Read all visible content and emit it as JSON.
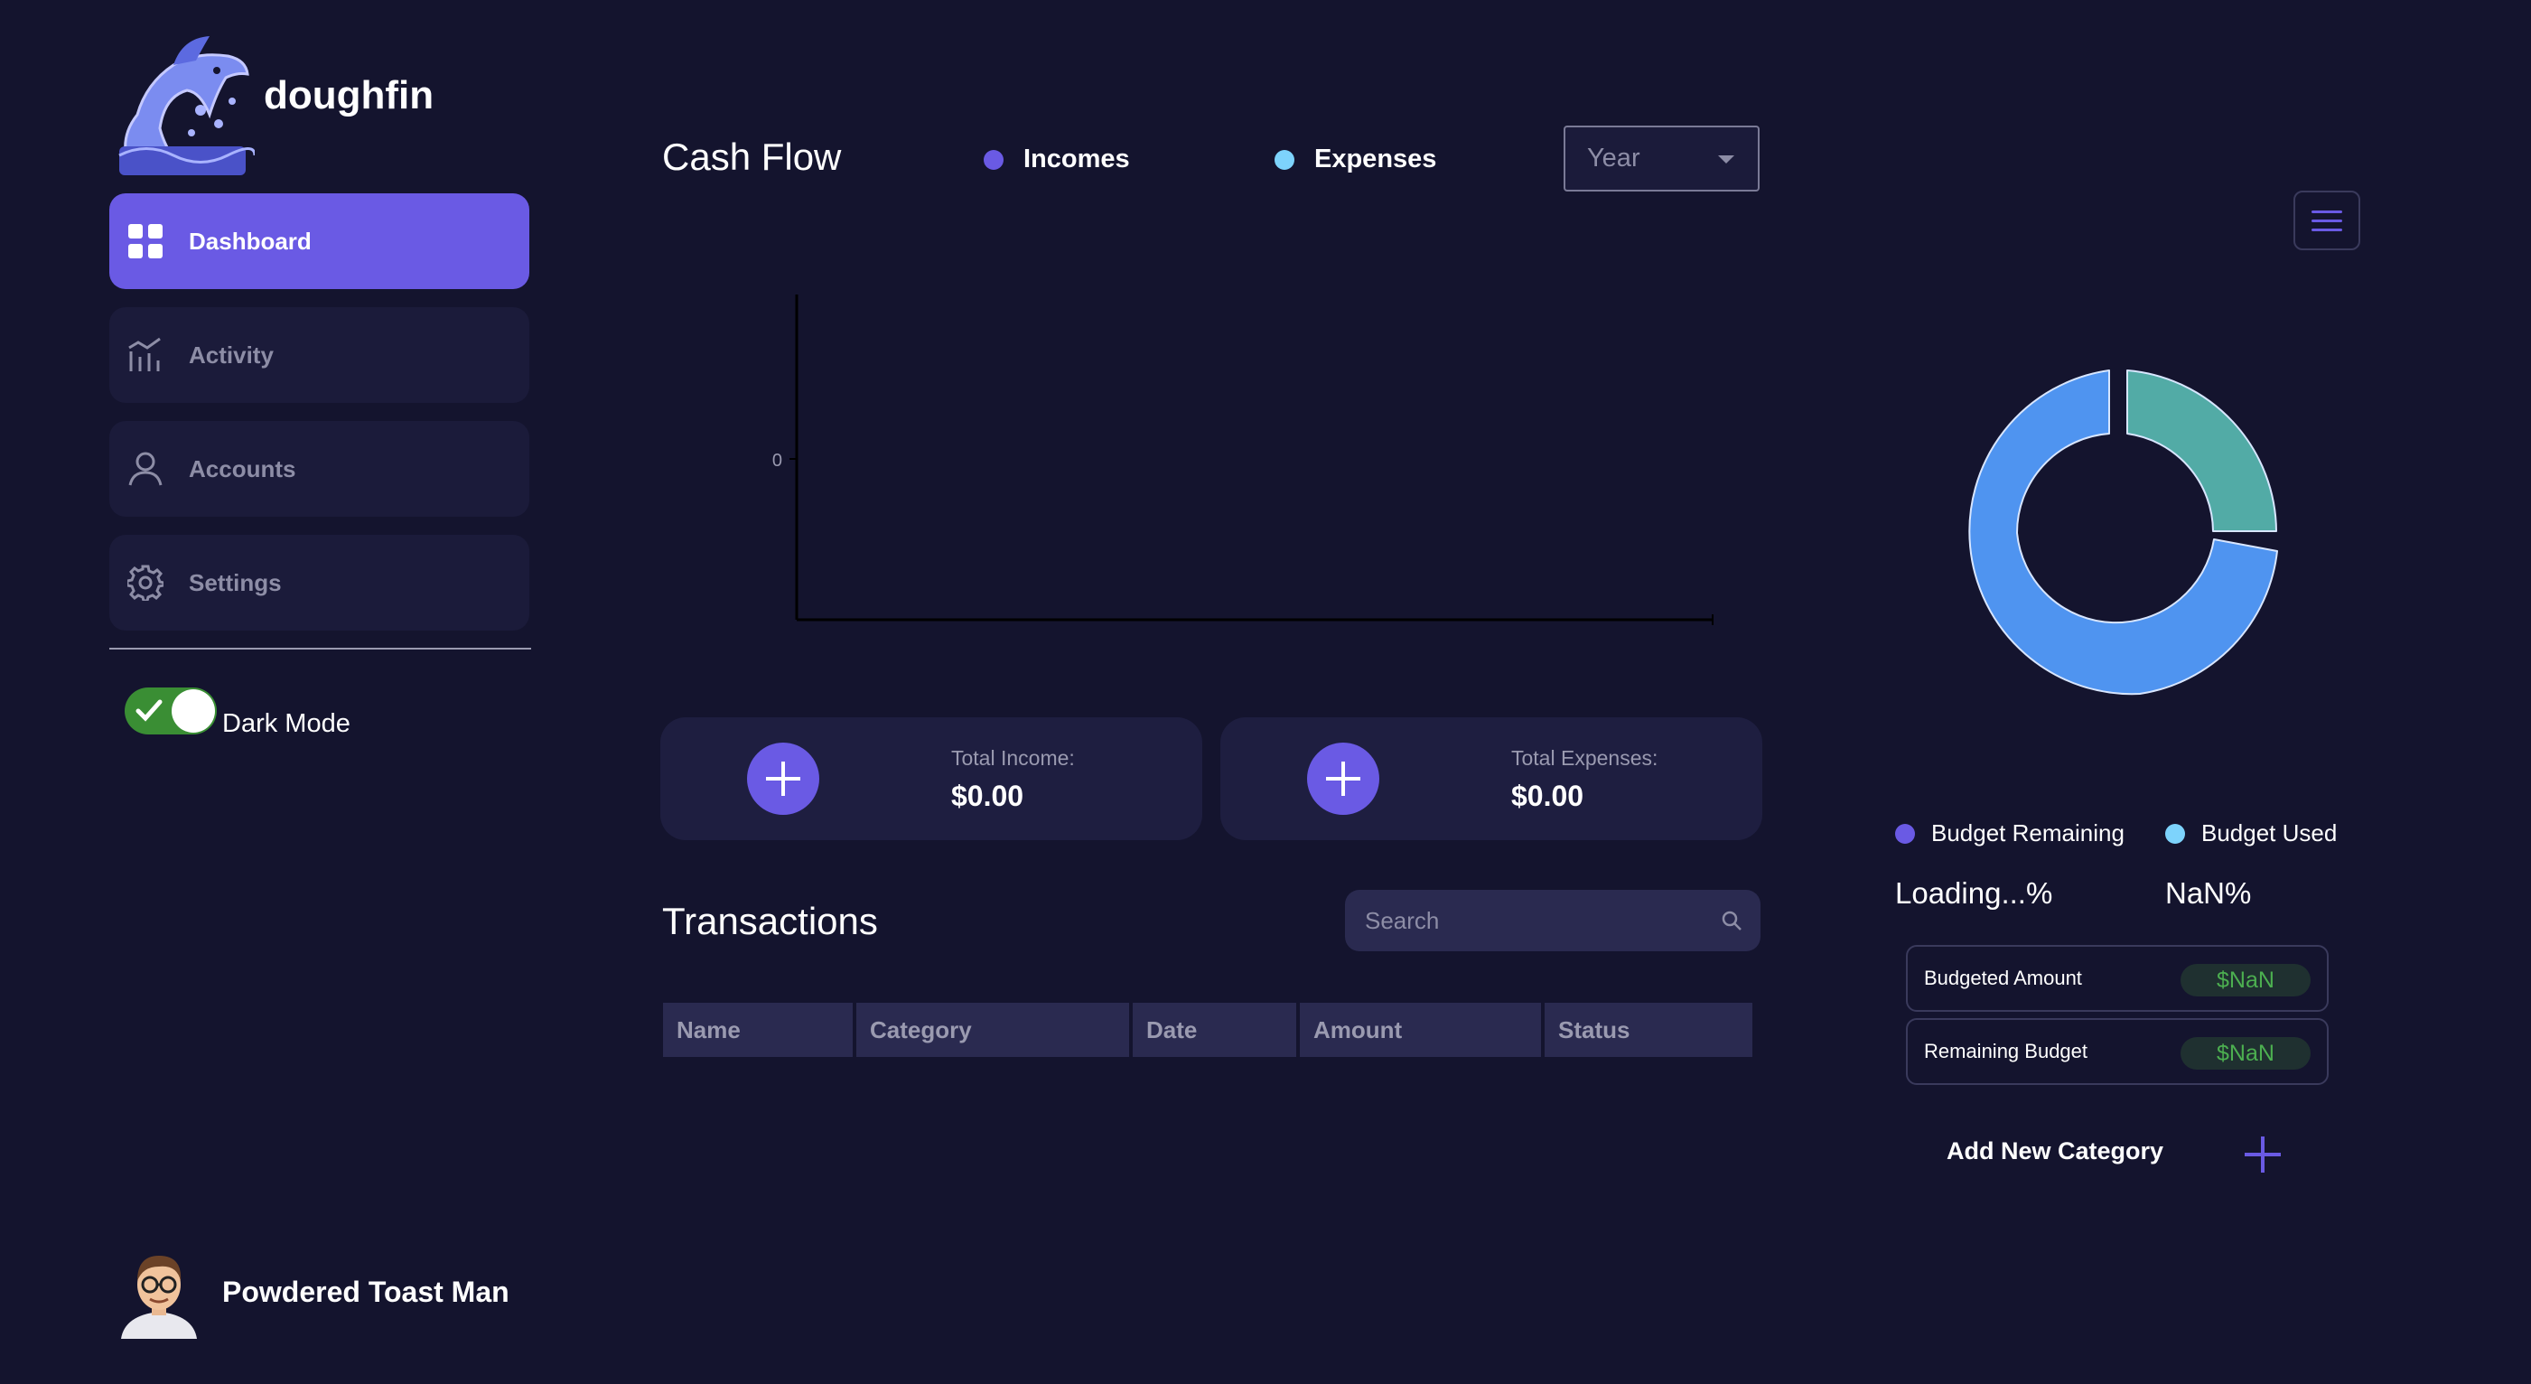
{
  "app": {
    "name": "doughfin"
  },
  "sidebar": {
    "items": [
      {
        "label": "Dashboard",
        "icon": "grid-icon",
        "active": true
      },
      {
        "label": "Activity",
        "icon": "activity-chart-icon",
        "active": false
      },
      {
        "label": "Accounts",
        "icon": "user-icon",
        "active": false
      },
      {
        "label": "Settings",
        "icon": "gear-icon",
        "active": false
      }
    ],
    "dark_mode": {
      "label": "Dark Mode",
      "enabled": true
    }
  },
  "user": {
    "name": "Powdered Toast Man"
  },
  "cash_flow": {
    "title": "Cash Flow",
    "legend": [
      {
        "label": "Incomes",
        "color": "#6a5ae4"
      },
      {
        "label": "Expenses",
        "color": "#7dd3fc"
      }
    ],
    "period_select": {
      "value": "Year"
    },
    "y_tick": "0"
  },
  "summary": {
    "income": {
      "label": "Total Income:",
      "value": "$0.00"
    },
    "expenses": {
      "label": "Total Expenses:",
      "value": "$0.00"
    }
  },
  "transactions": {
    "title": "Transactions",
    "search_placeholder": "Search",
    "columns": [
      "Name",
      "Category",
      "Date",
      "Amount",
      "Status"
    ]
  },
  "budget": {
    "legend": [
      {
        "label": "Budget Remaining",
        "color": "#6a5ae4"
      },
      {
        "label": "Budget Used",
        "color": "#7dd3fc"
      }
    ],
    "remaining_pct": "Loading...%",
    "used_pct": "NaN%",
    "rows": [
      {
        "label": "Budgeted Amount",
        "value": "$NaN"
      },
      {
        "label": "Remaining Budget",
        "value": "$NaN"
      }
    ],
    "add_category_label": "Add New Category",
    "colors": {
      "blue": "#4f94f0",
      "teal": "#52aba6"
    }
  }
}
